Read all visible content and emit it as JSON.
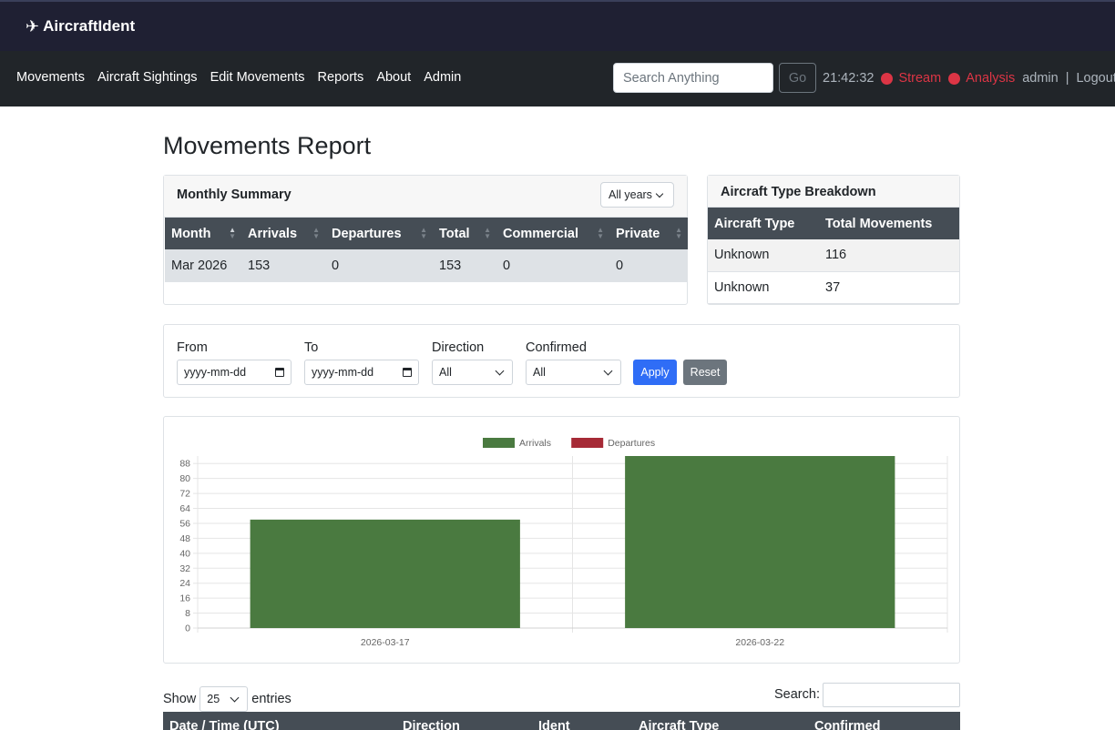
{
  "brand": {
    "name": "AircraftIdent",
    "icon": "airplane-icon"
  },
  "nav": {
    "links": [
      "Movements",
      "Aircraft Sightings",
      "Edit Movements",
      "Reports",
      "About",
      "Admin"
    ],
    "search_placeholder": "Search Anything",
    "go_label": "Go",
    "time": "21:42:32",
    "stream_label": "Stream",
    "analysis_label": "Analysis",
    "user": "admin",
    "separator": "|",
    "logout_label": "Logout",
    "status_color": "#dc3545"
  },
  "page_title": "Movements Report",
  "monthly_summary": {
    "title": "Monthly Summary",
    "year_filter": "All years",
    "columns": [
      "Month",
      "Arrivals",
      "Departures",
      "Total",
      "Commercial",
      "Private"
    ],
    "rows": [
      [
        "Mar 2026",
        "153",
        "0",
        "153",
        "0",
        "0"
      ]
    ]
  },
  "aircraft_breakdown": {
    "title": "Aircraft Type Breakdown",
    "columns": [
      "Aircraft Type",
      "Total Movements"
    ],
    "rows": [
      [
        "Unknown",
        "116"
      ],
      [
        "Unknown",
        "37"
      ]
    ]
  },
  "filters": {
    "from_label": "From",
    "from_placeholder": "yyyy-mm-dd",
    "to_label": "To",
    "to_placeholder": "yyyy-mm-dd",
    "direction_label": "Direction",
    "direction_value": "All",
    "confirmed_label": "Confirmed",
    "confirmed_value": "All",
    "apply_label": "Apply",
    "reset_label": "Reset"
  },
  "chart_data": {
    "type": "bar",
    "categories": [
      "2026-03-17",
      "2026-03-22"
    ],
    "series": [
      {
        "name": "Arrivals",
        "values": [
          58,
          92
        ],
        "color": "#4a7a40"
      },
      {
        "name": "Departures",
        "values": [
          0,
          0
        ],
        "color": "#a62a36"
      }
    ],
    "ylim": [
      0,
      92
    ],
    "yticks": [
      0,
      8,
      16,
      24,
      32,
      40,
      48,
      56,
      64,
      72,
      80,
      88
    ],
    "legend": "top",
    "grid": true,
    "title": "",
    "xlabel": "",
    "ylabel": ""
  },
  "entries": {
    "show_label": "Show",
    "count": "25",
    "suffix": "entries",
    "search_label": "Search:"
  },
  "movements_table": {
    "columns": [
      "Date / Time (UTC)",
      "Direction",
      "Ident",
      "Aircraft Type",
      "Confirmed"
    ]
  }
}
